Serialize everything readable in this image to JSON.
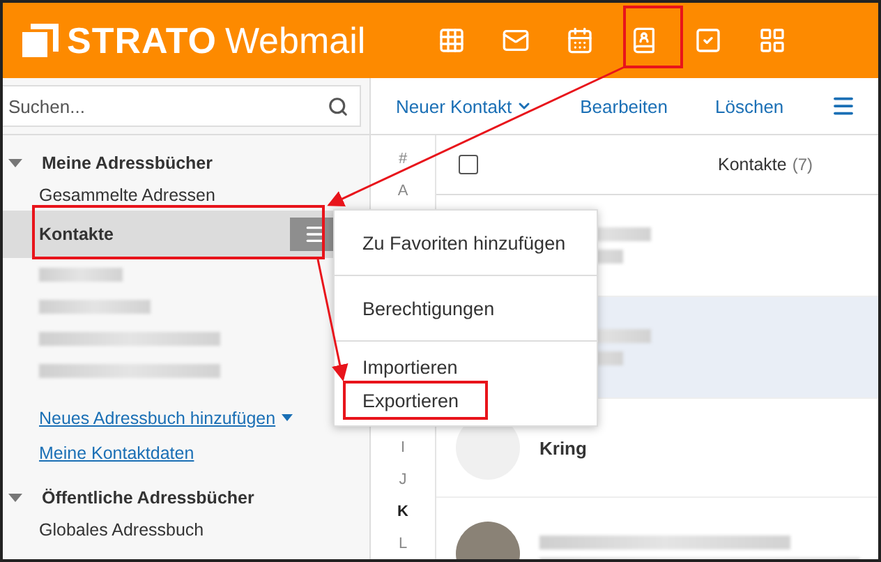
{
  "header": {
    "brand": "STRATO",
    "product": "Webmail"
  },
  "search": {
    "placeholder": "Suchen..."
  },
  "toolbar": {
    "new_contact": "Neuer Kontakt",
    "edit": "Bearbeiten",
    "delete": "Löschen"
  },
  "sidebar": {
    "sections": [
      {
        "title": "Meine Adressbücher",
        "expanded": true,
        "items": [
          {
            "label": "Gesammelte Adressen",
            "selected": false,
            "blurred": false
          },
          {
            "label": "Kontakte",
            "selected": true,
            "blurred": false
          },
          {
            "selected": false,
            "blurred": true
          },
          {
            "selected": false,
            "blurred": true
          },
          {
            "selected": false,
            "blurred": true
          },
          {
            "selected": false,
            "blurred": true
          }
        ],
        "links": [
          {
            "label": "Neues Adressbuch hinzufügen",
            "dropdown": true
          },
          {
            "label": "Meine Kontaktdaten",
            "dropdown": false
          }
        ]
      },
      {
        "title": "Öffentliche Adressbücher",
        "expanded": true,
        "items": [
          {
            "label": "Globales Adressbuch",
            "selected": false,
            "blurred": false
          }
        ]
      }
    ]
  },
  "letters_top": [
    {
      "label": "#",
      "selected": false
    },
    {
      "label": "A",
      "selected": false
    }
  ],
  "letters_bottom": [
    {
      "label": "I",
      "selected": false
    },
    {
      "label": "J",
      "selected": false
    },
    {
      "label": "K",
      "selected": true
    },
    {
      "label": "L",
      "selected": false
    }
  ],
  "list": {
    "title": "Kontakte",
    "count": "(7)",
    "checked": false,
    "rows": [
      {
        "kind": "blurred",
        "selected": false
      },
      {
        "kind": "blurred",
        "selected": true
      },
      {
        "kind": "initials",
        "name": "Kring",
        "selected": false
      },
      {
        "kind": "photo",
        "selected": false
      }
    ]
  },
  "context_menu": {
    "groups": [
      [
        "Zu Favoriten hinzufügen"
      ],
      [
        "Berechtigungen"
      ],
      [
        "Importieren",
        "Exportieren"
      ]
    ]
  }
}
